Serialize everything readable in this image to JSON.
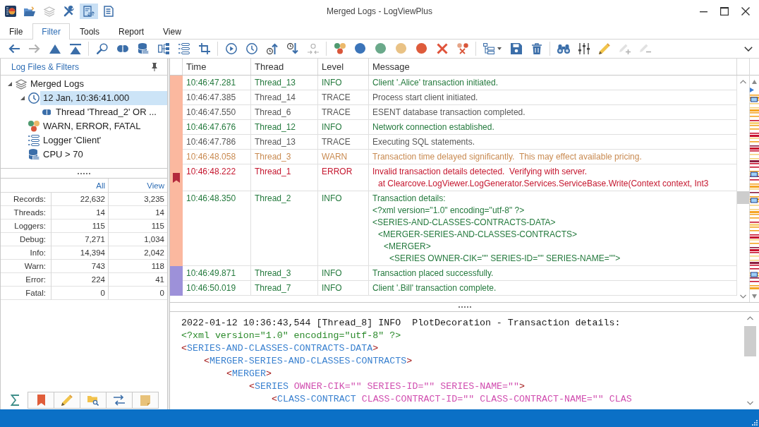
{
  "window": {
    "title": "Merged Logs - LogViewPlus"
  },
  "quick_access": [
    {
      "kind": "open",
      "on": false,
      "disabled": false
    },
    {
      "kind": "layers",
      "on": false,
      "disabled": true
    },
    {
      "kind": "tools",
      "on": false,
      "disabled": false
    },
    {
      "kind": "refresh",
      "on": true,
      "disabled": false
    },
    {
      "kind": "document",
      "on": false,
      "disabled": false
    }
  ],
  "menu_tabs": [
    {
      "label": "File",
      "selected": false
    },
    {
      "label": "Filter",
      "selected": true
    },
    {
      "label": "Tools",
      "selected": false
    },
    {
      "label": "Report",
      "selected": false
    },
    {
      "label": "View",
      "selected": false
    }
  ],
  "toolbar": [
    [
      {
        "kind": "back",
        "disabled": false
      },
      {
        "kind": "forward",
        "disabled": true
      },
      {
        "kind": "up",
        "disabled": false
      },
      {
        "kind": "top",
        "disabled": false
      }
    ],
    [
      {
        "kind": "search",
        "disabled": false
      },
      {
        "kind": "link",
        "disabled": false
      },
      {
        "kind": "sql",
        "disabled": false
      },
      {
        "kind": "hierarchy",
        "disabled": false
      },
      {
        "kind": "list",
        "disabled": false
      },
      {
        "kind": "crop",
        "disabled": false
      }
    ],
    [
      {
        "kind": "play",
        "disabled": false
      },
      {
        "kind": "clock",
        "disabled": false
      },
      {
        "kind": "clockup",
        "disabled": false
      },
      {
        "kind": "clockdown",
        "disabled": false
      },
      {
        "kind": "merge",
        "disabled": true
      }
    ],
    [
      {
        "kind": "levels",
        "disabled": false
      },
      {
        "kind": "dot",
        "color": "#3b74b9",
        "disabled": false
      },
      {
        "kind": "dot",
        "color": "#6aa98a",
        "disabled": false
      },
      {
        "kind": "dot",
        "color": "#e9c285",
        "disabled": false
      },
      {
        "kind": "dot",
        "color": "#de5b3b",
        "disabled": false
      },
      {
        "kind": "cross",
        "disabled": false
      },
      {
        "kind": "clearlevels",
        "disabled": false
      }
    ],
    [
      {
        "kind": "treelist",
        "disabled": false
      },
      {
        "kind": "save",
        "disabled": false
      },
      {
        "kind": "trash",
        "disabled": false
      }
    ],
    [
      {
        "kind": "binoculars",
        "disabled": false
      },
      {
        "kind": "sliders",
        "disabled": false
      },
      {
        "kind": "pencil",
        "disabled": false
      },
      {
        "kind": "pencilplus",
        "disabled": true
      },
      {
        "kind": "pencilminus",
        "disabled": true
      }
    ]
  ],
  "sidebar": {
    "title": "Log Files & Filters",
    "tree": [
      {
        "label": "Merged Logs",
        "kind": "merged",
        "expanded": true,
        "selected": false,
        "children": [
          {
            "label": "12 Jan, 10:36:41.000",
            "kind": "time",
            "expanded": true,
            "selected": true,
            "children": [
              {
                "label": "Thread 'Thread_2' OR ...",
                "kind": "thread",
                "selected": false
              }
            ]
          },
          {
            "label": "WARN, ERROR, FATAL",
            "kind": "level",
            "selected": false
          },
          {
            "label": "Logger 'Client'",
            "kind": "logger",
            "selected": false
          },
          {
            "label": "CPU > 70",
            "kind": "sql",
            "selected": false
          }
        ]
      }
    ],
    "stats": {
      "columns": [
        "All",
        "View"
      ],
      "rows": [
        {
          "label": "Records:",
          "values": [
            "22,632",
            "3,235"
          ]
        },
        {
          "label": "Threads:",
          "values": [
            "14",
            "14"
          ]
        },
        {
          "label": "Loggers:",
          "values": [
            "115",
            "115"
          ]
        },
        {
          "label": "Debug:",
          "values": [
            "7,271",
            "1,034"
          ]
        },
        {
          "label": "Info:",
          "values": [
            "14,394",
            "2,042"
          ]
        },
        {
          "label": "Warn:",
          "values": [
            "743",
            "118"
          ]
        },
        {
          "label": "Error:",
          "values": [
            "224",
            "41"
          ]
        },
        {
          "label": "Fatal:",
          "values": [
            "0",
            "0"
          ]
        }
      ]
    },
    "tabs": [
      {
        "kind": "summary",
        "selected": true
      },
      {
        "kind": "bookmarks",
        "selected": false
      },
      {
        "kind": "notes",
        "selected": false
      },
      {
        "kind": "search",
        "selected": false
      },
      {
        "kind": "compare",
        "selected": false
      },
      {
        "kind": "clipboard",
        "selected": false
      }
    ]
  },
  "log_table": {
    "columns": [
      "Time",
      "Thread",
      "Level",
      "Message"
    ],
    "rows": [
      {
        "time": "10:46:47.281",
        "thread": "Thread_13",
        "level": "INFO",
        "kind": "info",
        "color": "#fbb89f",
        "bookmarked": false,
        "message": [
          {
            "text": "Client '.Alice' transaction initiated."
          }
        ]
      },
      {
        "time": "10:46:47.385",
        "thread": "Thread_14",
        "level": "TRACE",
        "kind": "trace",
        "color": "#fbb89f",
        "bookmarked": false,
        "message": [
          {
            "text": "Process start client initiated."
          }
        ]
      },
      {
        "time": "10:46:47.550",
        "thread": "Thread_6",
        "level": "TRACE",
        "kind": "trace",
        "color": "#fbb89f",
        "bookmarked": false,
        "message": [
          {
            "text": "ESENT database transaction completed."
          }
        ]
      },
      {
        "time": "10:46:47.676",
        "thread": "Thread_12",
        "level": "INFO",
        "kind": "info",
        "color": "#fbb89f",
        "bookmarked": false,
        "message": [
          {
            "text": "Network connection established."
          }
        ]
      },
      {
        "time": "10:46:47.786",
        "thread": "Thread_13",
        "level": "TRACE",
        "kind": "trace",
        "color": "#fbb89f",
        "bookmarked": false,
        "message": [
          {
            "text": "Executing SQL statements."
          }
        ]
      },
      {
        "time": "10:46:48.058",
        "thread": "Thread_3",
        "level": "WARN",
        "kind": "warn",
        "color": "#fbb89f",
        "bookmarked": false,
        "message": [
          {
            "text": "Transaction time delayed significantly.  This may effect available pricing."
          }
        ]
      },
      {
        "time": "10:46:48.222",
        "thread": "Thread_1",
        "level": "ERROR",
        "kind": "error",
        "color": "#fbb89f",
        "bookmarked": true,
        "message": [
          {
            "text": "Invalid transaction details detected.  Verifying with server.",
            "children": [
              {
                "text": "at Clearcove.LogViewer.LogGenerator.Services.ServiceBase.Write(Context context, Int3"
              }
            ]
          }
        ]
      },
      {
        "time": "10:46:48.350",
        "thread": "Thread_2",
        "level": "INFO",
        "kind": "info",
        "color": "#fbb89f",
        "bookmarked": false,
        "message": [
          {
            "text": "Transaction details:"
          },
          {
            "text": "<?xml version=\"1.0\" encoding=\"utf-8\" ?>"
          },
          {
            "text": "<SERIES-AND-CLASSES-CONTRACTS-DATA>",
            "children": [
              {
                "text": "<MERGER-SERIES-AND-CLASSES-CONTRACTS>",
                "children": [
                  {
                    "text": "<MERGER>",
                    "children": [
                      {
                        "text": "<SERIES OWNER-CIK=\"\" SERIES-ID=\"\" SERIES-NAME=\"\">"
                      }
                    ]
                  }
                ]
              }
            ]
          }
        ]
      },
      {
        "time": "10:46:49.871",
        "thread": "Thread_3",
        "level": "INFO",
        "kind": "info",
        "color": "#9d91d9",
        "bookmarked": false,
        "message": [
          {
            "text": "Transaction placed successfully."
          }
        ]
      },
      {
        "time": "10:46:50.019",
        "thread": "Thread_7",
        "level": "INFO",
        "kind": "info",
        "color": "#9d91d9",
        "bookmarked": false,
        "message": [
          {
            "text": "Client '.Bill' transaction complete."
          }
        ]
      }
    ]
  },
  "detail": {
    "header": "2022-01-12 10:36:43,544 [Thread_8] INFO  PlotDecoration - Transaction details:",
    "declaration": "<?xml version=\"1.0\" encoding=\"utf-8\" ?>",
    "elements": [
      {
        "segments": [
          {
            "kind": "bracket",
            "text": "<"
          },
          {
            "kind": "tag",
            "text": "SERIES-AND-CLASSES-CONTRACTS-DATA"
          },
          {
            "kind": "bracket",
            "text": ">"
          }
        ],
        "children": [
          {
            "segments": [
              {
                "kind": "bracket",
                "text": "<"
              },
              {
                "kind": "tag",
                "text": "MERGER-SERIES-AND-CLASSES-CONTRACTS"
              },
              {
                "kind": "bracket",
                "text": ">"
              }
            ],
            "children": [
              {
                "segments": [
                  {
                    "kind": "bracket",
                    "text": "<"
                  },
                  {
                    "kind": "tag",
                    "text": "MERGER"
                  },
                  {
                    "kind": "bracket",
                    "text": ">"
                  }
                ],
                "children": [
                  {
                    "segments": [
                      {
                        "kind": "bracket",
                        "text": "<"
                      },
                      {
                        "kind": "tag",
                        "text": "SERIES"
                      },
                      {
                        "kind": "attr",
                        "text": " OWNER-CIK=\"\" SERIES-ID=\"\" SERIES-NAME=\"\""
                      },
                      {
                        "kind": "bracket",
                        "text": ">"
                      }
                    ],
                    "children": [
                      {
                        "segments": [
                          {
                            "kind": "bracket",
                            "text": "<"
                          },
                          {
                            "kind": "tag",
                            "text": "CLASS-CONTRACT"
                          },
                          {
                            "kind": "attr",
                            "text": " CLASS-CONTRACT-ID=\"\" CLASS-CONTRACT-NAME=\"\" CLAS"
                          }
                        ]
                      }
                    ]
                  }
                ]
              }
            ]
          }
        ]
      }
    ]
  }
}
